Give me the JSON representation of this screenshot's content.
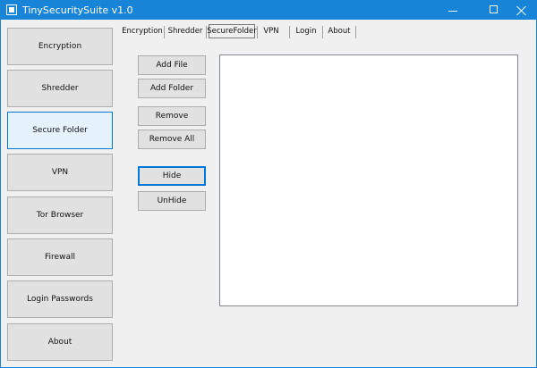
{
  "window": {
    "title": "TinySecuritySuite v1.0"
  },
  "sidebar": {
    "items": [
      {
        "label": "Encryption"
      },
      {
        "label": "Shredder"
      },
      {
        "label": "Secure Folder"
      },
      {
        "label": "VPN"
      },
      {
        "label": "Tor Browser"
      },
      {
        "label": "Firewall"
      },
      {
        "label": "Login Passwords"
      },
      {
        "label": "About"
      }
    ],
    "selected": "Secure Folder"
  },
  "tabs": {
    "items": [
      {
        "label": "Encryption"
      },
      {
        "label": "Shredder"
      },
      {
        "label": "SecureFolder"
      },
      {
        "label": "VPN"
      },
      {
        "label": "Login"
      },
      {
        "label": "About"
      }
    ],
    "selected": "SecureFolder"
  },
  "actions": {
    "add_file": "Add File",
    "add_folder": "Add Folder",
    "remove": "Remove",
    "remove_all": "Remove All",
    "hide": "Hide",
    "unhide": "UnHide"
  },
  "colors": {
    "titlebar": "#1884d7",
    "window_bg": "#f0f0f0",
    "button_face": "#e1e1e1",
    "selected_button": "#e5f1fb",
    "focus_border": "#0078d7"
  },
  "icons": {
    "app": "app-icon",
    "minimize": "minimize-icon",
    "maximize": "maximize-icon",
    "close": "close-icon"
  }
}
